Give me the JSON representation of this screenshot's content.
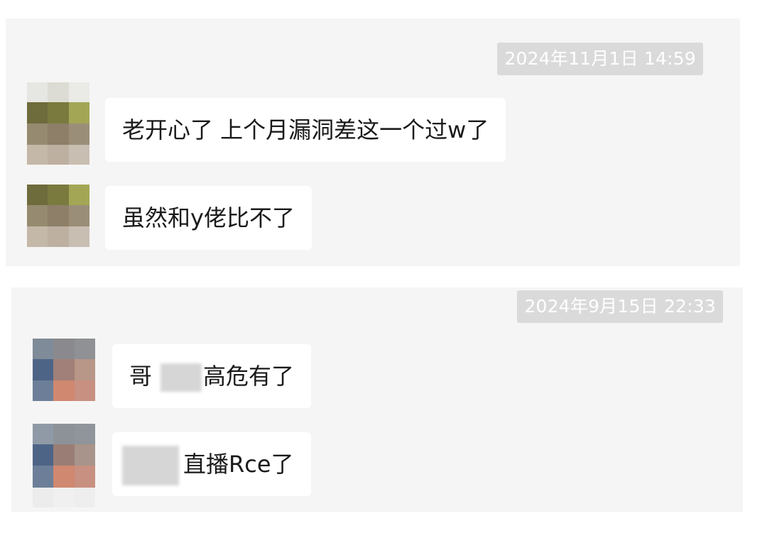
{
  "conversations": [
    {
      "timestamp": "2024年11月1日 14:59",
      "messages": [
        {
          "text": "老开心了 上个月漏洞差这一个过w了"
        },
        {
          "text": "虽然和y佬比不了"
        }
      ]
    },
    {
      "timestamp": "2024年9月15日 22:33",
      "messages": [
        {
          "prefix": "哥",
          "suffix": "高危有了"
        },
        {
          "suffix": "直播Rce了"
        }
      ]
    }
  ],
  "colors": {
    "panel_bg": "#f5f5f5",
    "bubble_bg": "#ffffff",
    "timestamp_bg": "#dadada",
    "timestamp_text": "#ffffff",
    "text": "#1a1a1a"
  },
  "icons": {
    "avatar_1": "pixelated-avatar-icon",
    "avatar_2": "pixelated-avatar-icon"
  }
}
